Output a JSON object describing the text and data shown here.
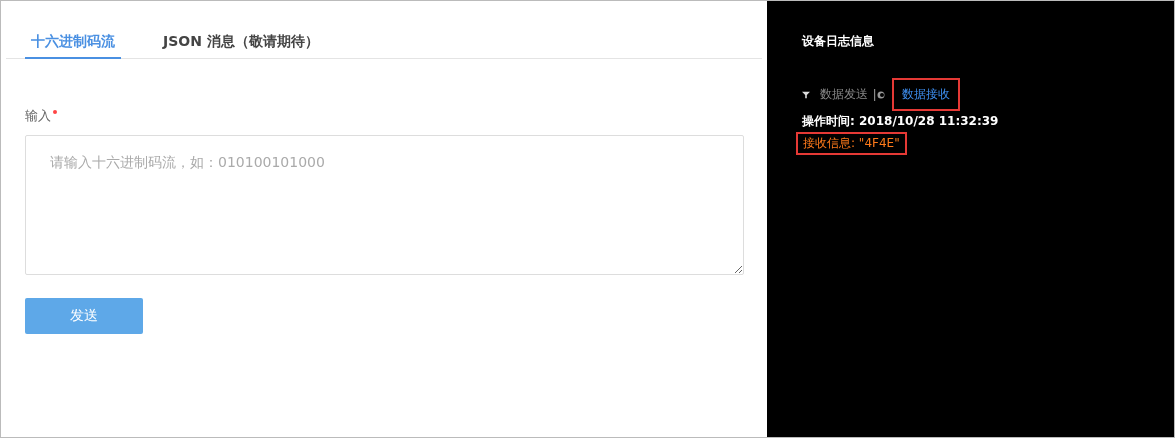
{
  "tabs": [
    {
      "label": "十六进制码流",
      "selected": true
    },
    {
      "label": "JSON 消息（敬请期待）",
      "selected": false
    }
  ],
  "form": {
    "label": "输入",
    "required": true,
    "placeholder": "请输入十六进制码流，如：010100101000",
    "button": "发送"
  },
  "log": {
    "title": "设备日志信息",
    "filters": [
      {
        "label": "数据发送",
        "selected": false,
        "highlighted": false
      },
      {
        "label": "数据接收",
        "selected": true,
        "highlighted": true
      }
    ],
    "lines": [
      {
        "kind": "time",
        "text": "操作时间: 2018/10/28 11:32:39",
        "highlighted": false
      },
      {
        "kind": "message",
        "text": "接收信息: \"4F4E\"",
        "highlighted": true
      }
    ]
  }
}
